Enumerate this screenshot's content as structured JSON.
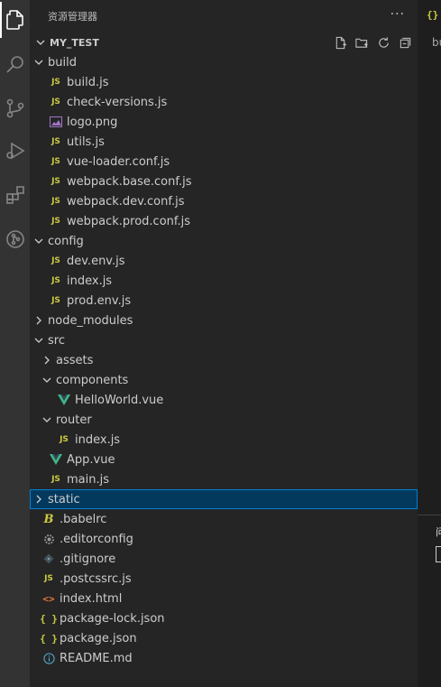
{
  "activity_bar": {
    "icons": [
      "explorer-icon",
      "search-icon",
      "source-control-icon",
      "run-debug-icon",
      "extensions-icon",
      "remote-icon"
    ]
  },
  "explorer": {
    "title": "资源管理器",
    "more": "···",
    "project": "MY_TEST",
    "actions": [
      "new-file-icon",
      "new-folder-icon",
      "refresh-icon",
      "collapse-all-icon"
    ]
  },
  "tree": [
    {
      "label": "build",
      "type": "folder",
      "open": true,
      "depth": 1
    },
    {
      "label": "build.js",
      "type": "js",
      "depth": 2
    },
    {
      "label": "check-versions.js",
      "type": "js",
      "depth": 2
    },
    {
      "label": "logo.png",
      "type": "image",
      "depth": 2
    },
    {
      "label": "utils.js",
      "type": "js",
      "depth": 2
    },
    {
      "label": "vue-loader.conf.js",
      "type": "js",
      "depth": 2
    },
    {
      "label": "webpack.base.conf.js",
      "type": "js",
      "depth": 2
    },
    {
      "label": "webpack.dev.conf.js",
      "type": "js",
      "depth": 2
    },
    {
      "label": "webpack.prod.conf.js",
      "type": "js",
      "depth": 2
    },
    {
      "label": "config",
      "type": "folder",
      "open": true,
      "depth": 1
    },
    {
      "label": "dev.env.js",
      "type": "js",
      "depth": 2
    },
    {
      "label": "index.js",
      "type": "js",
      "depth": 2
    },
    {
      "label": "prod.env.js",
      "type": "js",
      "depth": 2
    },
    {
      "label": "node_modules",
      "type": "folder",
      "open": false,
      "depth": 1
    },
    {
      "label": "src",
      "type": "folder",
      "open": true,
      "depth": 1
    },
    {
      "label": "assets",
      "type": "folder",
      "open": false,
      "depth": 2
    },
    {
      "label": "components",
      "type": "folder",
      "open": true,
      "depth": 2
    },
    {
      "label": "HelloWorld.vue",
      "type": "vue",
      "depth": 3
    },
    {
      "label": "router",
      "type": "folder",
      "open": true,
      "depth": 2
    },
    {
      "label": "index.js",
      "type": "js",
      "depth": 3
    },
    {
      "label": "App.vue",
      "type": "vue",
      "depth": 2
    },
    {
      "label": "main.js",
      "type": "js",
      "depth": 2
    },
    {
      "label": "static",
      "type": "folder",
      "open": false,
      "depth": 1,
      "selected": true
    },
    {
      "label": ".babelrc",
      "type": "babel",
      "depth": 1
    },
    {
      "label": ".editorconfig",
      "type": "gear",
      "depth": 1
    },
    {
      "label": ".gitignore",
      "type": "git",
      "depth": 1
    },
    {
      "label": ".postcssrc.js",
      "type": "js",
      "depth": 1
    },
    {
      "label": "index.html",
      "type": "html",
      "depth": 1
    },
    {
      "label": "package-lock.json",
      "type": "json",
      "depth": 1
    },
    {
      "label": "package.json",
      "type": "json",
      "depth": 1
    },
    {
      "label": "README.md",
      "type": "info",
      "depth": 1
    }
  ],
  "icon_glyphs": {
    "js": "JS",
    "json": "{ }",
    "html": "<>"
  },
  "editor": {
    "tab_icon": "{}",
    "breadcrumb": "bu",
    "panel_title": "问"
  },
  "colors": {
    "accent": "#007fd4",
    "selection": "#04395e",
    "js_yellow": "#cbcb41",
    "vue_green": "#41b883",
    "html_orange": "#e37933",
    "info_blue": "#519aba"
  }
}
